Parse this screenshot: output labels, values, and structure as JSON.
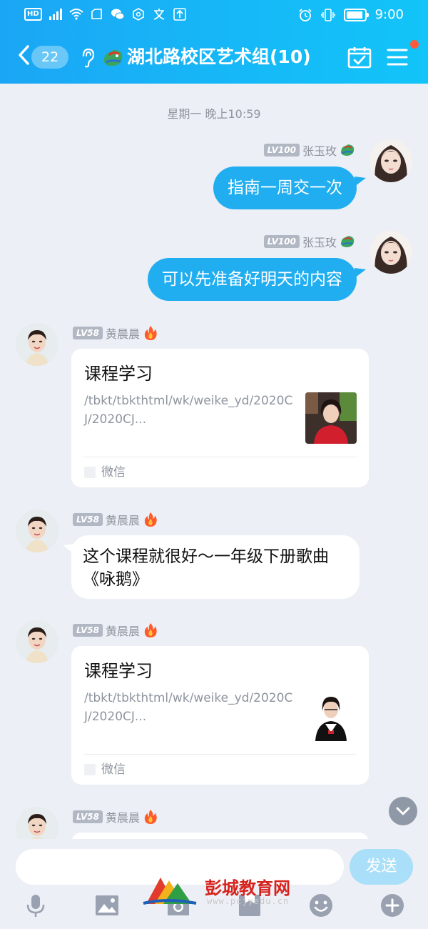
{
  "status_bar": {
    "hd": "HD",
    "signal": "4G",
    "time": "9:00"
  },
  "header": {
    "unread_count": "22",
    "title": "湖北路校区艺术组(10)"
  },
  "timestamp": "星期一 晚上10:59",
  "messages": [
    {
      "side": "right",
      "level": "LV100",
      "sender": "张玉玫",
      "text": "指南一周交一次"
    },
    {
      "side": "right",
      "level": "LV100",
      "sender": "张玉玫",
      "text": "可以先准备好明天的内容"
    },
    {
      "side": "left",
      "level": "LV58",
      "sender": "黄晨晨",
      "card": {
        "title": "课程学习",
        "url": "/tbkt/tbkthtml/wk/weike_yd/2020CJ/2020CJ...",
        "source": "微信"
      }
    },
    {
      "side": "left",
      "level": "LV58",
      "sender": "黄晨晨",
      "text": "这个课程就很好～一年级下册歌曲《咏鹅》"
    },
    {
      "side": "left",
      "level": "LV58",
      "sender": "黄晨晨",
      "card": {
        "title": "课程学习",
        "url": "/tbkt/tbkthtml/wk/weike_yd/2020CJ/2020CJ...",
        "source": "微信"
      }
    },
    {
      "side": "left",
      "level": "LV58",
      "sender": "黄晨晨"
    }
  ],
  "input": {
    "placeholder": "",
    "send_label": "发送"
  },
  "toolbar": [
    "mic-icon",
    "image-icon",
    "camera-icon",
    "file-icon",
    "emoji-icon",
    "plus-icon"
  ],
  "watermark": {
    "text": "彭城教育网",
    "url": "www.pcjyedu.cn"
  },
  "colors": {
    "accent": "#20aef0",
    "header_start": "#1ba6f5",
    "header_end": "#12c4f8",
    "background": "#eceff5",
    "send_disabled": "#a9dff8"
  }
}
